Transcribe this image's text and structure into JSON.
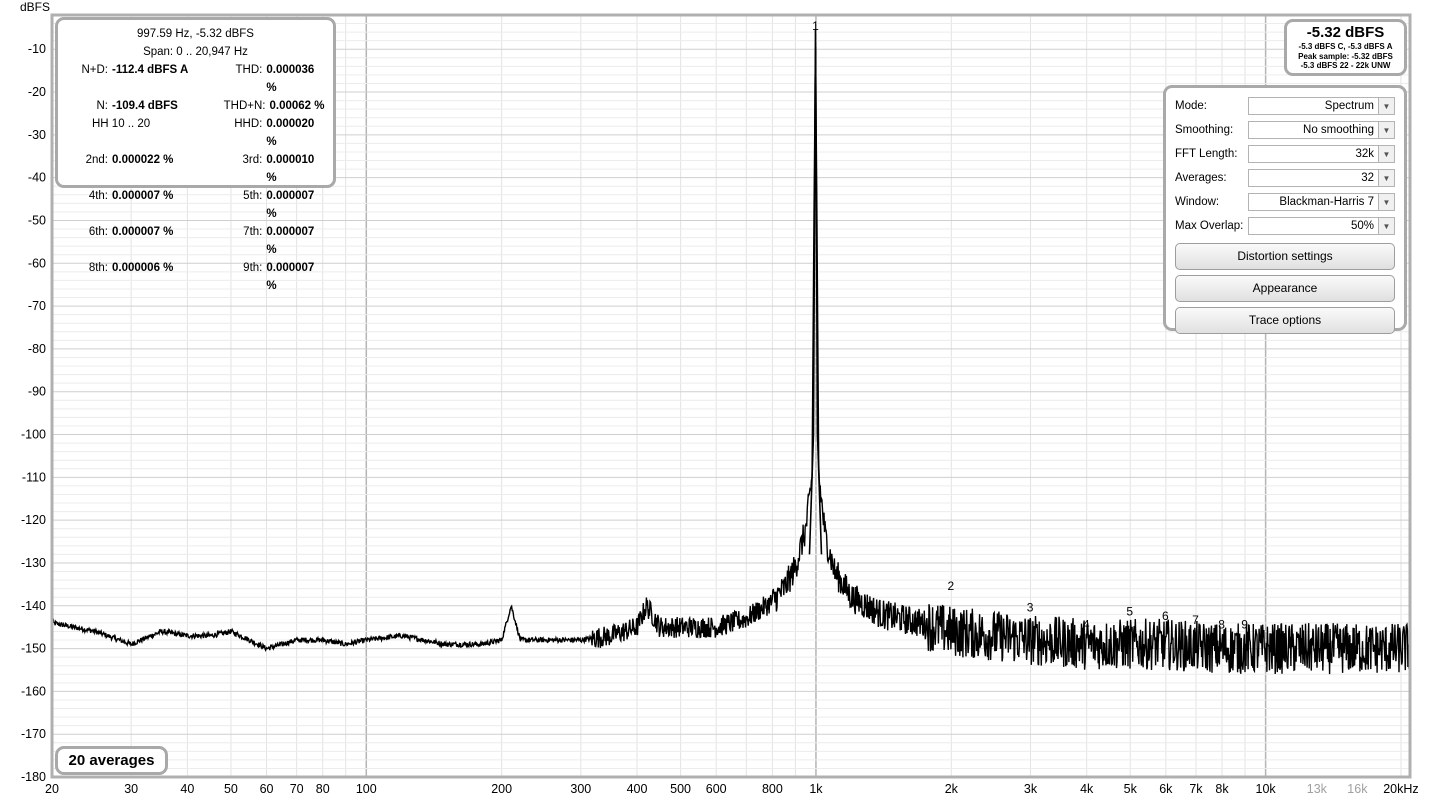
{
  "y_axis_unit": "dBFS",
  "x_axis_unit": "kHz",
  "y_ticks": [
    "-10",
    "-20",
    "-30",
    "-40",
    "-50",
    "-60",
    "-70",
    "-80",
    "-90",
    "-100",
    "-110",
    "-120",
    "-130",
    "-140",
    "-150",
    "-160",
    "-170",
    "-180"
  ],
  "x_ticks": [
    {
      "f": 20,
      "label": "20"
    },
    {
      "f": 30,
      "label": "30"
    },
    {
      "f": 40,
      "label": "40"
    },
    {
      "f": 50,
      "label": "50"
    },
    {
      "f": 60,
      "label": "60"
    },
    {
      "f": 70,
      "label": "70"
    },
    {
      "f": 80,
      "label": "80"
    },
    {
      "f": 100,
      "label": "100"
    },
    {
      "f": 200,
      "label": "200"
    },
    {
      "f": 300,
      "label": "300"
    },
    {
      "f": 400,
      "label": "400"
    },
    {
      "f": 500,
      "label": "500"
    },
    {
      "f": 600,
      "label": "600"
    },
    {
      "f": 800,
      "label": "800"
    },
    {
      "f": 1000,
      "label": "1k"
    },
    {
      "f": 2000,
      "label": "2k"
    },
    {
      "f": 3000,
      "label": "3k"
    },
    {
      "f": 4000,
      "label": "4k"
    },
    {
      "f": 5000,
      "label": "5k"
    },
    {
      "f": 6000,
      "label": "6k"
    },
    {
      "f": 7000,
      "label": "7k"
    },
    {
      "f": 8000,
      "label": "8k"
    },
    {
      "f": 10000,
      "label": "10k"
    },
    {
      "f": 13000,
      "label": "13k"
    },
    {
      "f": 16000,
      "label": "16k"
    },
    {
      "f": 20000,
      "label": "20kHz"
    }
  ],
  "distortion": {
    "fundamental": "997.59 Hz, -5.32 dBFS",
    "span": "Span: 0 .. 20,947 Hz",
    "rows": [
      [
        {
          "label": "N+D:",
          "value": "-112.4 dBFS A"
        },
        {
          "label": "THD:",
          "value": "0.000036 %"
        }
      ],
      [
        {
          "label": "N:",
          "value": "-109.4 dBFS"
        },
        {
          "label": "THD+N:",
          "value": "0.00062 %"
        }
      ],
      [
        {
          "label": "HH 10 .. 20",
          "value": ""
        },
        {
          "label": "HHD:",
          "value": "0.000020 %"
        }
      ],
      [
        {
          "label": "2nd:",
          "value": "0.000022 %"
        },
        {
          "label": "3rd:",
          "value": "0.000010 %"
        }
      ],
      [
        {
          "label": "4th:",
          "value": "0.000007 %"
        },
        {
          "label": "5th:",
          "value": "0.000007 %"
        }
      ],
      [
        {
          "label": "6th:",
          "value": "0.000007 %"
        },
        {
          "label": "7th:",
          "value": "0.000007 %"
        }
      ],
      [
        {
          "label": "8th:",
          "value": "0.000006 %"
        },
        {
          "label": "9th:",
          "value": "0.000007 %"
        }
      ]
    ]
  },
  "level": {
    "main": "-5.32 dBFS",
    "line1": "-5.3 dBFS C, -5.3 dBFS A",
    "line2": "Peak sample: -5.32 dBFS",
    "line3": "-5.3 dBFS 22 - 22k UNW"
  },
  "controls": {
    "mode": {
      "label": "Mode:",
      "value": "Spectrum"
    },
    "smoothing": {
      "label": "Smoothing:",
      "value": "No smoothing"
    },
    "fft_length": {
      "label": "FFT Length:",
      "value": "32k"
    },
    "averages": {
      "label": "Averages:",
      "value": "32"
    },
    "window": {
      "label": "Window:",
      "value": "Blackman-Harris 7"
    },
    "max_overlap": {
      "label": "Max Overlap:",
      "value": "50%"
    },
    "distortion_btn": "Distortion settings",
    "appearance_btn": "Appearance",
    "trace_btn": "Trace options"
  },
  "avg_badge": "20 averages",
  "harmonic_markers": [
    {
      "n": "1",
      "f": 997.59,
      "db": -8
    },
    {
      "n": "2",
      "f": 1995,
      "db": -137
    },
    {
      "n": "3",
      "f": 2993,
      "db": -142
    },
    {
      "n": "4",
      "f": 3990,
      "db": -146
    },
    {
      "n": "5",
      "f": 4988,
      "db": -143
    },
    {
      "n": "6",
      "f": 5986,
      "db": -144
    },
    {
      "n": "7",
      "f": 6983,
      "db": -145
    },
    {
      "n": "8",
      "f": 7981,
      "db": -146
    },
    {
      "n": "9",
      "f": 8978,
      "db": -146
    }
  ],
  "chart_data": {
    "type": "line",
    "xscale": "log",
    "xlim": [
      20,
      20947
    ],
    "ylim": [
      -180,
      -2
    ],
    "series": [
      {
        "x": [
          20,
          25,
          30,
          35,
          40,
          45,
          50,
          55,
          60,
          65,
          70,
          80,
          90,
          100,
          120,
          150,
          180,
          200,
          210,
          220,
          250,
          300,
          350,
          400,
          420,
          450,
          500,
          600,
          700,
          800,
          850,
          900,
          950,
          980,
          997.59,
          1015,
          1050,
          1100,
          1200,
          1400,
          1700,
          2000,
          2500,
          3000,
          4000,
          5000,
          6000,
          8000,
          10000,
          14000,
          17000,
          20947
        ],
        "y": [
          -144,
          -146,
          -149,
          -146,
          -147,
          -147,
          -146,
          -148,
          -150,
          -149,
          -148,
          -148,
          -149,
          -148,
          -147,
          -149,
          -149,
          -148,
          -140,
          -148,
          -148,
          -148,
          -147,
          -145,
          -140,
          -145,
          -145,
          -145,
          -143,
          -139,
          -136,
          -131,
          -122,
          -110,
          -5.32,
          -110,
          -124,
          -132,
          -138,
          -142,
          -144,
          -146,
          -147,
          -148,
          -149,
          -149,
          -149,
          -150,
          -150,
          -150,
          -150,
          -150
        ]
      }
    ]
  }
}
